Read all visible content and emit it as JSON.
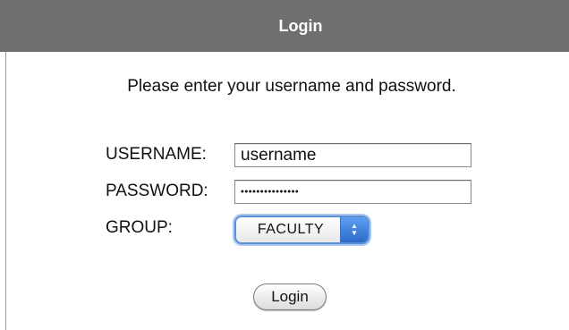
{
  "header": {
    "title": "Login",
    "background": "#6f6f6f",
    "text_color": "#ffffff"
  },
  "instructions": "Please enter your username and password.",
  "form": {
    "username_label": "USERNAME:",
    "username_value": "username",
    "password_label": "PASSWORD:",
    "password_value": "•••••••••••••••",
    "group_label": "GROUP:",
    "group_selected": "FACULTY",
    "submit_label": "Login"
  },
  "icons": {
    "select_arrows": "up-down-chevron-icon"
  },
  "colors": {
    "select_accent": "#2b69c9",
    "focus_ring": "#a9c7ef"
  }
}
